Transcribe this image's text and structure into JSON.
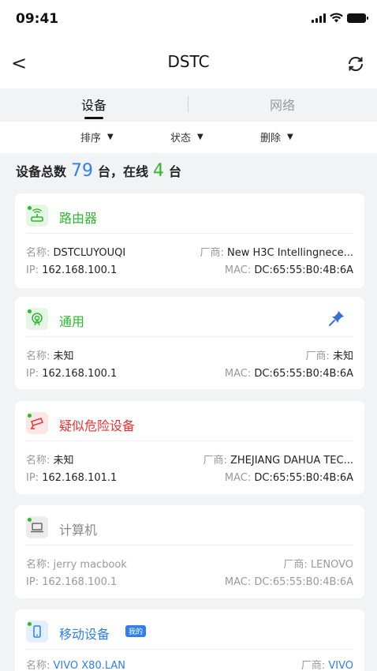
{
  "status": {
    "time": "09:41"
  },
  "nav": {
    "title": "DSTC",
    "back": "<"
  },
  "tabs": {
    "device": "设备",
    "network": "网络"
  },
  "filters": {
    "sort": "排序",
    "status": "状态",
    "delete": "删除",
    "caret": "▼"
  },
  "summary": {
    "prefix": "设备总数",
    "total": "79",
    "mid": "台，在线",
    "online": "4",
    "suffix": "台"
  },
  "labels": {
    "name": "名称: ",
    "vendor": "厂商: ",
    "ip": "IP: ",
    "mac": "MAC: "
  },
  "colors": {
    "accent_blue": "#2f80ed",
    "online_green": "#2eb82e",
    "danger_red": "#f0302e"
  },
  "devices": [
    {
      "type": "路由器",
      "icon": "router-icon",
      "name": "DSTCLUYOUQI",
      "vendor": "New H3C Intellingnece...",
      "ip": "162.168.100.1",
      "mac": "DC:65:55:B0:4B:6A"
    },
    {
      "type": "通用",
      "icon": "generic-device-icon",
      "name": "未知",
      "vendor": "未知",
      "ip": "162.168.100.1",
      "mac": "DC:65:55:B0:4B:6A",
      "pinned": true
    },
    {
      "type": "疑似危险设备",
      "icon": "camera-icon",
      "name": "未知",
      "vendor": "ZHEJIANG  DAHUA TEC...",
      "ip": "162.168.101.1",
      "mac": "DC:65:55:B0:4B:6A"
    },
    {
      "type": "计算机",
      "icon": "laptop-icon",
      "name": "jerry macbook",
      "vendor": "LENOVO",
      "ip": "162.168.100.1",
      "mac": "DC:65:55:B0:4B:6A"
    },
    {
      "type": "移动设备",
      "icon": "mobile-icon",
      "badge": "我的",
      "name": "VIVO X80.LAN",
      "vendor": "VIVO"
    }
  ]
}
